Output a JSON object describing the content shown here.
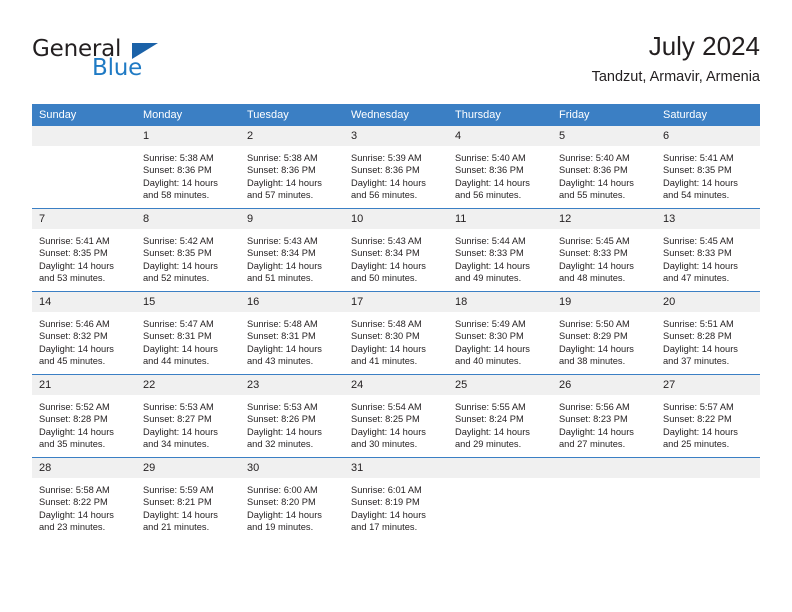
{
  "brand": {
    "word1": "General",
    "word2": "Blue",
    "logo_icon": "triangle-icon"
  },
  "header": {
    "title": "July 2024",
    "subtitle": "Tandzut, Armavir, Armenia"
  },
  "calendar": {
    "accent_color": "#3b7fc4",
    "daynum_bg": "#f0f0f0",
    "weekday_headers": [
      "Sunday",
      "Monday",
      "Tuesday",
      "Wednesday",
      "Thursday",
      "Friday",
      "Saturday"
    ],
    "weeks": [
      [
        {
          "day": "",
          "sunrise": "",
          "sunset": "",
          "daylight1": "",
          "daylight2": ""
        },
        {
          "day": "1",
          "sunrise": "Sunrise: 5:38 AM",
          "sunset": "Sunset: 8:36 PM",
          "daylight1": "Daylight: 14 hours",
          "daylight2": "and 58 minutes."
        },
        {
          "day": "2",
          "sunrise": "Sunrise: 5:38 AM",
          "sunset": "Sunset: 8:36 PM",
          "daylight1": "Daylight: 14 hours",
          "daylight2": "and 57 minutes."
        },
        {
          "day": "3",
          "sunrise": "Sunrise: 5:39 AM",
          "sunset": "Sunset: 8:36 PM",
          "daylight1": "Daylight: 14 hours",
          "daylight2": "and 56 minutes."
        },
        {
          "day": "4",
          "sunrise": "Sunrise: 5:40 AM",
          "sunset": "Sunset: 8:36 PM",
          "daylight1": "Daylight: 14 hours",
          "daylight2": "and 56 minutes."
        },
        {
          "day": "5",
          "sunrise": "Sunrise: 5:40 AM",
          "sunset": "Sunset: 8:36 PM",
          "daylight1": "Daylight: 14 hours",
          "daylight2": "and 55 minutes."
        },
        {
          "day": "6",
          "sunrise": "Sunrise: 5:41 AM",
          "sunset": "Sunset: 8:35 PM",
          "daylight1": "Daylight: 14 hours",
          "daylight2": "and 54 minutes."
        }
      ],
      [
        {
          "day": "7",
          "sunrise": "Sunrise: 5:41 AM",
          "sunset": "Sunset: 8:35 PM",
          "daylight1": "Daylight: 14 hours",
          "daylight2": "and 53 minutes."
        },
        {
          "day": "8",
          "sunrise": "Sunrise: 5:42 AM",
          "sunset": "Sunset: 8:35 PM",
          "daylight1": "Daylight: 14 hours",
          "daylight2": "and 52 minutes."
        },
        {
          "day": "9",
          "sunrise": "Sunrise: 5:43 AM",
          "sunset": "Sunset: 8:34 PM",
          "daylight1": "Daylight: 14 hours",
          "daylight2": "and 51 minutes."
        },
        {
          "day": "10",
          "sunrise": "Sunrise: 5:43 AM",
          "sunset": "Sunset: 8:34 PM",
          "daylight1": "Daylight: 14 hours",
          "daylight2": "and 50 minutes."
        },
        {
          "day": "11",
          "sunrise": "Sunrise: 5:44 AM",
          "sunset": "Sunset: 8:33 PM",
          "daylight1": "Daylight: 14 hours",
          "daylight2": "and 49 minutes."
        },
        {
          "day": "12",
          "sunrise": "Sunrise: 5:45 AM",
          "sunset": "Sunset: 8:33 PM",
          "daylight1": "Daylight: 14 hours",
          "daylight2": "and 48 minutes."
        },
        {
          "day": "13",
          "sunrise": "Sunrise: 5:45 AM",
          "sunset": "Sunset: 8:33 PM",
          "daylight1": "Daylight: 14 hours",
          "daylight2": "and 47 minutes."
        }
      ],
      [
        {
          "day": "14",
          "sunrise": "Sunrise: 5:46 AM",
          "sunset": "Sunset: 8:32 PM",
          "daylight1": "Daylight: 14 hours",
          "daylight2": "and 45 minutes."
        },
        {
          "day": "15",
          "sunrise": "Sunrise: 5:47 AM",
          "sunset": "Sunset: 8:31 PM",
          "daylight1": "Daylight: 14 hours",
          "daylight2": "and 44 minutes."
        },
        {
          "day": "16",
          "sunrise": "Sunrise: 5:48 AM",
          "sunset": "Sunset: 8:31 PM",
          "daylight1": "Daylight: 14 hours",
          "daylight2": "and 43 minutes."
        },
        {
          "day": "17",
          "sunrise": "Sunrise: 5:48 AM",
          "sunset": "Sunset: 8:30 PM",
          "daylight1": "Daylight: 14 hours",
          "daylight2": "and 41 minutes."
        },
        {
          "day": "18",
          "sunrise": "Sunrise: 5:49 AM",
          "sunset": "Sunset: 8:30 PM",
          "daylight1": "Daylight: 14 hours",
          "daylight2": "and 40 minutes."
        },
        {
          "day": "19",
          "sunrise": "Sunrise: 5:50 AM",
          "sunset": "Sunset: 8:29 PM",
          "daylight1": "Daylight: 14 hours",
          "daylight2": "and 38 minutes."
        },
        {
          "day": "20",
          "sunrise": "Sunrise: 5:51 AM",
          "sunset": "Sunset: 8:28 PM",
          "daylight1": "Daylight: 14 hours",
          "daylight2": "and 37 minutes."
        }
      ],
      [
        {
          "day": "21",
          "sunrise": "Sunrise: 5:52 AM",
          "sunset": "Sunset: 8:28 PM",
          "daylight1": "Daylight: 14 hours",
          "daylight2": "and 35 minutes."
        },
        {
          "day": "22",
          "sunrise": "Sunrise: 5:53 AM",
          "sunset": "Sunset: 8:27 PM",
          "daylight1": "Daylight: 14 hours",
          "daylight2": "and 34 minutes."
        },
        {
          "day": "23",
          "sunrise": "Sunrise: 5:53 AM",
          "sunset": "Sunset: 8:26 PM",
          "daylight1": "Daylight: 14 hours",
          "daylight2": "and 32 minutes."
        },
        {
          "day": "24",
          "sunrise": "Sunrise: 5:54 AM",
          "sunset": "Sunset: 8:25 PM",
          "daylight1": "Daylight: 14 hours",
          "daylight2": "and 30 minutes."
        },
        {
          "day": "25",
          "sunrise": "Sunrise: 5:55 AM",
          "sunset": "Sunset: 8:24 PM",
          "daylight1": "Daylight: 14 hours",
          "daylight2": "and 29 minutes."
        },
        {
          "day": "26",
          "sunrise": "Sunrise: 5:56 AM",
          "sunset": "Sunset: 8:23 PM",
          "daylight1": "Daylight: 14 hours",
          "daylight2": "and 27 minutes."
        },
        {
          "day": "27",
          "sunrise": "Sunrise: 5:57 AM",
          "sunset": "Sunset: 8:22 PM",
          "daylight1": "Daylight: 14 hours",
          "daylight2": "and 25 minutes."
        }
      ],
      [
        {
          "day": "28",
          "sunrise": "Sunrise: 5:58 AM",
          "sunset": "Sunset: 8:22 PM",
          "daylight1": "Daylight: 14 hours",
          "daylight2": "and 23 minutes."
        },
        {
          "day": "29",
          "sunrise": "Sunrise: 5:59 AM",
          "sunset": "Sunset: 8:21 PM",
          "daylight1": "Daylight: 14 hours",
          "daylight2": "and 21 minutes."
        },
        {
          "day": "30",
          "sunrise": "Sunrise: 6:00 AM",
          "sunset": "Sunset: 8:20 PM",
          "daylight1": "Daylight: 14 hours",
          "daylight2": "and 19 minutes."
        },
        {
          "day": "31",
          "sunrise": "Sunrise: 6:01 AM",
          "sunset": "Sunset: 8:19 PM",
          "daylight1": "Daylight: 14 hours",
          "daylight2": "and 17 minutes."
        },
        {
          "day": "",
          "sunrise": "",
          "sunset": "",
          "daylight1": "",
          "daylight2": ""
        },
        {
          "day": "",
          "sunrise": "",
          "sunset": "",
          "daylight1": "",
          "daylight2": ""
        },
        {
          "day": "",
          "sunrise": "",
          "sunset": "",
          "daylight1": "",
          "daylight2": ""
        }
      ]
    ]
  }
}
